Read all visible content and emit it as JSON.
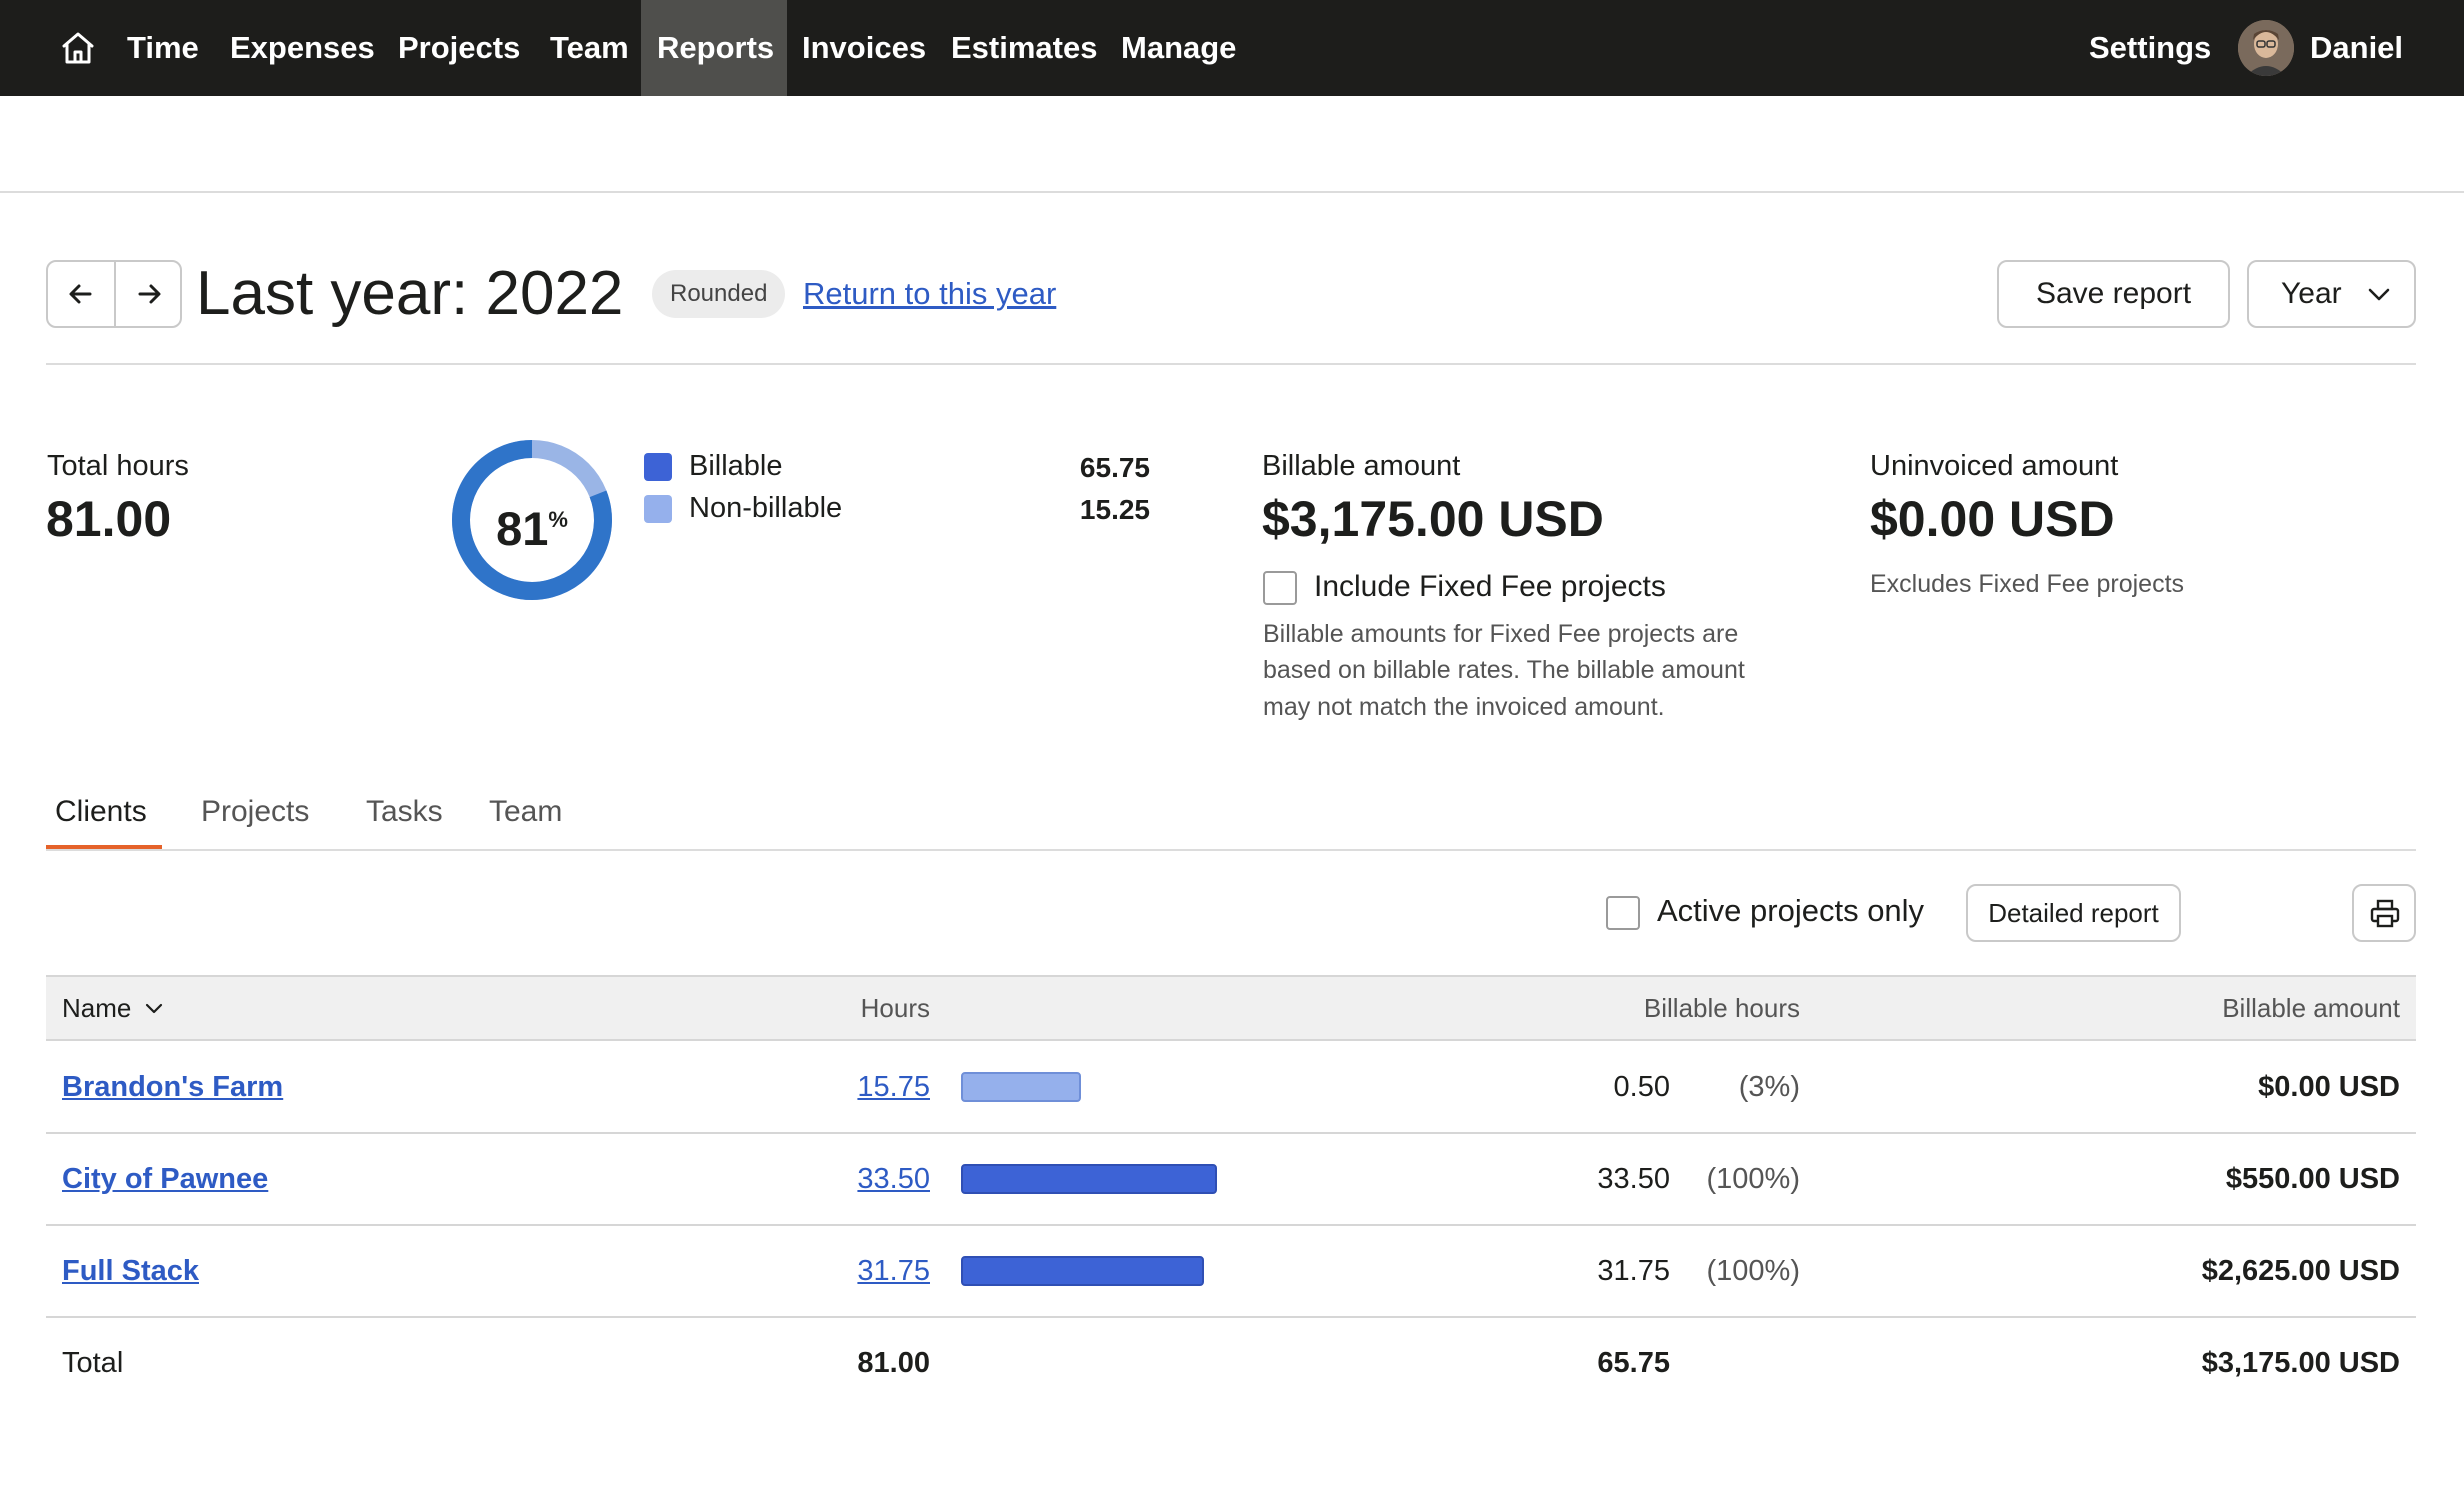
{
  "nav": {
    "items": [
      {
        "label": "Time"
      },
      {
        "label": "Expenses"
      },
      {
        "label": "Projects"
      },
      {
        "label": "Team"
      },
      {
        "label": "Reports",
        "active": true
      },
      {
        "label": "Invoices"
      },
      {
        "label": "Estimates"
      },
      {
        "label": "Manage"
      }
    ],
    "settings": "Settings",
    "user": "Daniel"
  },
  "header": {
    "title": "Last year: 2022",
    "badge": "Rounded",
    "return_link": "Return to this year",
    "save_report": "Save report",
    "period_select": "Year"
  },
  "summary": {
    "total_hours_label": "Total hours",
    "total_hours": "81.00",
    "donut_percent": "81",
    "donut_percent_sign": "%",
    "billable_fraction": 0.81,
    "billable_label": "Billable",
    "billable_hours": "65.75",
    "non_billable_label": "Non-billable",
    "non_billable_hours": "15.25",
    "billable_amount_label": "Billable amount",
    "billable_amount": "$3,175.00 USD",
    "include_fixed_fee": "Include Fixed Fee projects",
    "include_fixed_fee_checked": false,
    "fixed_fee_note_lines": [
      "Billable amounts for Fixed Fee projects are",
      "based on billable rates. The billable amount",
      "may not match the invoiced amount."
    ],
    "uninvoiced_label": "Uninvoiced amount",
    "uninvoiced_amount": "$0.00 USD",
    "uninvoiced_note": "Excludes Fixed Fee projects"
  },
  "tabs": [
    {
      "label": "Clients",
      "active": true
    },
    {
      "label": "Projects"
    },
    {
      "label": "Tasks"
    },
    {
      "label": "Team"
    }
  ],
  "toolbar": {
    "active_only": "Active projects only",
    "active_only_checked": false,
    "detailed_report": "Detailed report"
  },
  "table": {
    "columns": {
      "name": "Name",
      "hours": "Hours",
      "billable_hours": "Billable hours",
      "billable_amount": "Billable amount"
    },
    "rows": [
      {
        "name": "Brandon's Farm",
        "hours": "15.75",
        "billable_hours": "0.50",
        "billable_pct": "(3%)",
        "billable_amount": "$0.00 USD",
        "bar_fraction": 0.47,
        "bar_kind": "nonbillable"
      },
      {
        "name": "City of Pawnee",
        "hours": "33.50",
        "billable_hours": "33.50",
        "billable_pct": "(100%)",
        "billable_amount": "$550.00 USD",
        "bar_fraction": 1.0,
        "bar_kind": "billable"
      },
      {
        "name": "Full Stack",
        "hours": "31.75",
        "billable_hours": "31.75",
        "billable_pct": "(100%)",
        "billable_amount": "$2,625.00 USD",
        "bar_fraction": 0.95,
        "bar_kind": "billable"
      }
    ],
    "total": {
      "label": "Total",
      "hours": "81.00",
      "billable_hours": "65.75",
      "billable_amount": "$3,175.00 USD"
    }
  },
  "colors": {
    "billable": "#3d63d6",
    "non_billable": "#95b0ec",
    "donut_main": "#2f74c9",
    "donut_light": "#9ab5e6",
    "nav_bg": "#1d1d1b",
    "nav_active": "#4f4f4c",
    "link": "#2e5bc4",
    "tab_underline": "#e5622a"
  },
  "icons": {
    "home": "home-icon",
    "prev": "arrow-left-icon",
    "next": "arrow-right-icon",
    "chevron": "chevron-down-icon",
    "print": "printer-icon",
    "sort": "chevron-down-icon"
  }
}
